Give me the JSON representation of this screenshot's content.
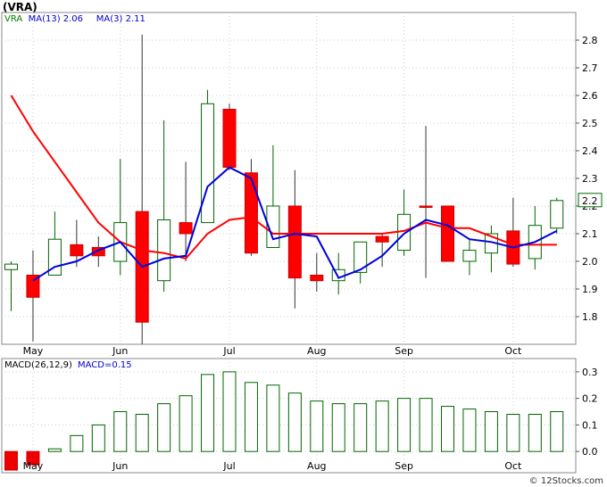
{
  "chart_data": [
    {
      "type": "candlestick",
      "title": "(VRA)",
      "legend": [
        {
          "label": "VRA",
          "color": "#008000"
        },
        {
          "label": "MA(13)",
          "value": "2.06",
          "color": "#0000cc"
        },
        {
          "label": "MA(3)",
          "value": "2.11",
          "color": "#0000cc"
        }
      ],
      "ylim": [
        1.7,
        2.9
      ],
      "y_ticks": [
        "1.8",
        "1.9",
        "2.0",
        "2.1",
        "2.2",
        "2.3",
        "2.4",
        "2.5",
        "2.6",
        "2.7",
        "2.8"
      ],
      "x_month_labels": [
        {
          "label": "May",
          "index": 1
        },
        {
          "label": "Jun",
          "index": 5
        },
        {
          "label": "Jul",
          "index": 10
        },
        {
          "label": "Aug",
          "index": 14
        },
        {
          "label": "Sep",
          "index": 18
        },
        {
          "label": "Oct",
          "index": 23
        }
      ],
      "last_price_label": "2.2",
      "candles": [
        {
          "o": 1.97,
          "h": 2.0,
          "l": 1.82,
          "c": 1.99,
          "up": true
        },
        {
          "o": 1.95,
          "h": 2.04,
          "l": 1.71,
          "c": 1.87,
          "up": false
        },
        {
          "o": 1.95,
          "h": 2.18,
          "l": 1.95,
          "c": 2.08,
          "up": true
        },
        {
          "o": 2.06,
          "h": 2.15,
          "l": 1.98,
          "c": 2.02,
          "up": false
        },
        {
          "o": 2.05,
          "h": 2.09,
          "l": 1.98,
          "c": 2.02,
          "up": false
        },
        {
          "o": 2.0,
          "h": 2.37,
          "l": 1.95,
          "c": 2.14,
          "up": true
        },
        {
          "o": 2.18,
          "h": 2.82,
          "l": 1.7,
          "c": 1.78,
          "up": false
        },
        {
          "o": 1.93,
          "h": 2.51,
          "l": 1.89,
          "c": 2.15,
          "up": true
        },
        {
          "o": 2.14,
          "h": 2.36,
          "l": 2.0,
          "c": 2.1,
          "up": false
        },
        {
          "o": 2.14,
          "h": 2.62,
          "l": 2.14,
          "c": 2.57,
          "up": true
        },
        {
          "o": 2.55,
          "h": 2.57,
          "l": 2.33,
          "c": 2.34,
          "up": false
        },
        {
          "o": 2.32,
          "h": 2.37,
          "l": 2.02,
          "c": 2.03,
          "up": false
        },
        {
          "o": 2.05,
          "h": 2.42,
          "l": 2.05,
          "c": 2.2,
          "up": true
        },
        {
          "o": 2.2,
          "h": 2.33,
          "l": 1.83,
          "c": 1.94,
          "up": false
        },
        {
          "o": 1.95,
          "h": 2.03,
          "l": 1.89,
          "c": 1.93,
          "up": false
        },
        {
          "o": 1.93,
          "h": 2.03,
          "l": 1.88,
          "c": 1.97,
          "up": true
        },
        {
          "o": 1.96,
          "h": 2.07,
          "l": 1.92,
          "c": 2.07,
          "up": true
        },
        {
          "o": 2.09,
          "h": 2.1,
          "l": 1.98,
          "c": 2.07,
          "up": false
        },
        {
          "o": 2.04,
          "h": 2.26,
          "l": 2.02,
          "c": 2.17,
          "up": true
        },
        {
          "o": 2.2,
          "h": 2.49,
          "l": 1.94,
          "c": 2.2,
          "up": false
        },
        {
          "o": 2.2,
          "h": 2.2,
          "l": 2.0,
          "c": 2.0,
          "up": false
        },
        {
          "o": 2.0,
          "h": 2.08,
          "l": 1.95,
          "c": 2.04,
          "up": true
        },
        {
          "o": 2.03,
          "h": 2.13,
          "l": 1.96,
          "c": 2.1,
          "up": true
        },
        {
          "o": 2.11,
          "h": 2.23,
          "l": 1.98,
          "c": 1.99,
          "up": false
        },
        {
          "o": 2.01,
          "h": 2.2,
          "l": 1.97,
          "c": 2.13,
          "up": true
        },
        {
          "o": 2.12,
          "h": 2.23,
          "l": 2.1,
          "c": 2.22,
          "up": true
        }
      ],
      "series": [
        {
          "name": "MA(13)",
          "color": "#ff0000",
          "points": [
            [
              0,
              2.6
            ],
            [
              1,
              2.47
            ],
            [
              2,
              2.36
            ],
            [
              3,
              2.25
            ],
            [
              4,
              2.14
            ],
            [
              5,
              2.07
            ],
            [
              6,
              2.04
            ],
            [
              7,
              2.03
            ],
            [
              8,
              2.01
            ],
            [
              9,
              2.1
            ],
            [
              10,
              2.15
            ],
            [
              11,
              2.16
            ],
            [
              12,
              2.1
            ],
            [
              13,
              2.1
            ],
            [
              14,
              2.1
            ],
            [
              15,
              2.1
            ],
            [
              16,
              2.1
            ],
            [
              17,
              2.1
            ],
            [
              18,
              2.11
            ],
            [
              19,
              2.14
            ],
            [
              20,
              2.12
            ],
            [
              21,
              2.12
            ],
            [
              22,
              2.09
            ],
            [
              23,
              2.06
            ],
            [
              24,
              2.06
            ],
            [
              25,
              2.06
            ]
          ]
        },
        {
          "name": "MA(3)",
          "color": "#0000dd",
          "points": [
            [
              1,
              1.93
            ],
            [
              2,
              1.98
            ],
            [
              3,
              2.0
            ],
            [
              4,
              2.04
            ],
            [
              5,
              2.07
            ],
            [
              6,
              1.98
            ],
            [
              7,
              2.01
            ],
            [
              8,
              2.02
            ],
            [
              9,
              2.27
            ],
            [
              10,
              2.34
            ],
            [
              11,
              2.3
            ],
            [
              12,
              2.08
            ],
            [
              13,
              2.1
            ],
            [
              14,
              2.09
            ],
            [
              15,
              1.94
            ],
            [
              16,
              1.97
            ],
            [
              17,
              2.02
            ],
            [
              18,
              2.1
            ],
            [
              19,
              2.15
            ],
            [
              20,
              2.13
            ],
            [
              21,
              2.08
            ],
            [
              22,
              2.07
            ],
            [
              23,
              2.05
            ],
            [
              24,
              2.07
            ],
            [
              25,
              2.11
            ]
          ]
        }
      ]
    },
    {
      "type": "bar",
      "title": "MACD(26,12,9)",
      "legend": [
        {
          "label": "MACD(26,12,9)",
          "color": "#000000"
        },
        {
          "label": "MACD=0.15",
          "color": "#0000cc"
        }
      ],
      "ylim": [
        -0.08,
        0.35
      ],
      "y_ticks": [
        "0.0",
        "0.1",
        "0.2",
        "0.3"
      ],
      "x_month_labels": [
        {
          "label": "May",
          "index": 1
        },
        {
          "label": "Jun",
          "index": 5
        },
        {
          "label": "Jul",
          "index": 10
        },
        {
          "label": "Aug",
          "index": 14
        },
        {
          "label": "Sep",
          "index": 18
        },
        {
          "label": "Oct",
          "index": 23
        }
      ],
      "values": [
        -0.07,
        -0.05,
        0.01,
        0.06,
        0.1,
        0.15,
        0.14,
        0.18,
        0.21,
        0.29,
        0.3,
        0.26,
        0.25,
        0.22,
        0.19,
        0.18,
        0.18,
        0.19,
        0.2,
        0.2,
        0.17,
        0.16,
        0.15,
        0.14,
        0.14,
        0.15
      ]
    }
  ]
}
